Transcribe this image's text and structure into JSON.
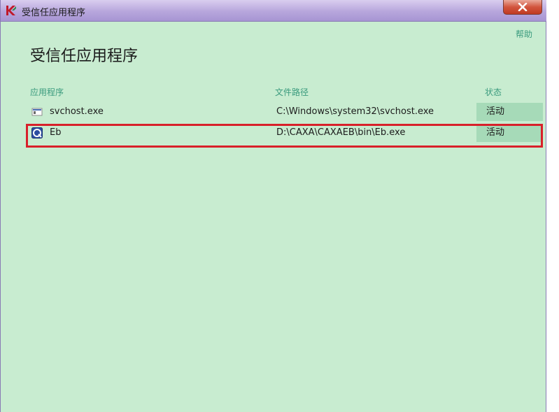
{
  "window": {
    "title": "受信任应用程序"
  },
  "header": {
    "help_label": "帮助",
    "page_title": "受信任应用程序"
  },
  "table": {
    "columns": {
      "application": "应用程序",
      "file_path": "文件路径",
      "status": "状态"
    },
    "rows": [
      {
        "name": "svchost.exe",
        "path": "C:\\Windows\\system32\\svchost.exe",
        "status": "活动",
        "icon": "exe-file-icon"
      },
      {
        "name": "Eb",
        "path": "D:\\CAXA\\CAXAEB\\bin\\Eb.exe",
        "status": "活动",
        "icon": "caxa-app-icon"
      }
    ]
  },
  "colors": {
    "background": "#c8ecd0",
    "accent_text": "#3b9b7e",
    "highlight": "#d8202a",
    "status_bg": "#a6dab8"
  }
}
